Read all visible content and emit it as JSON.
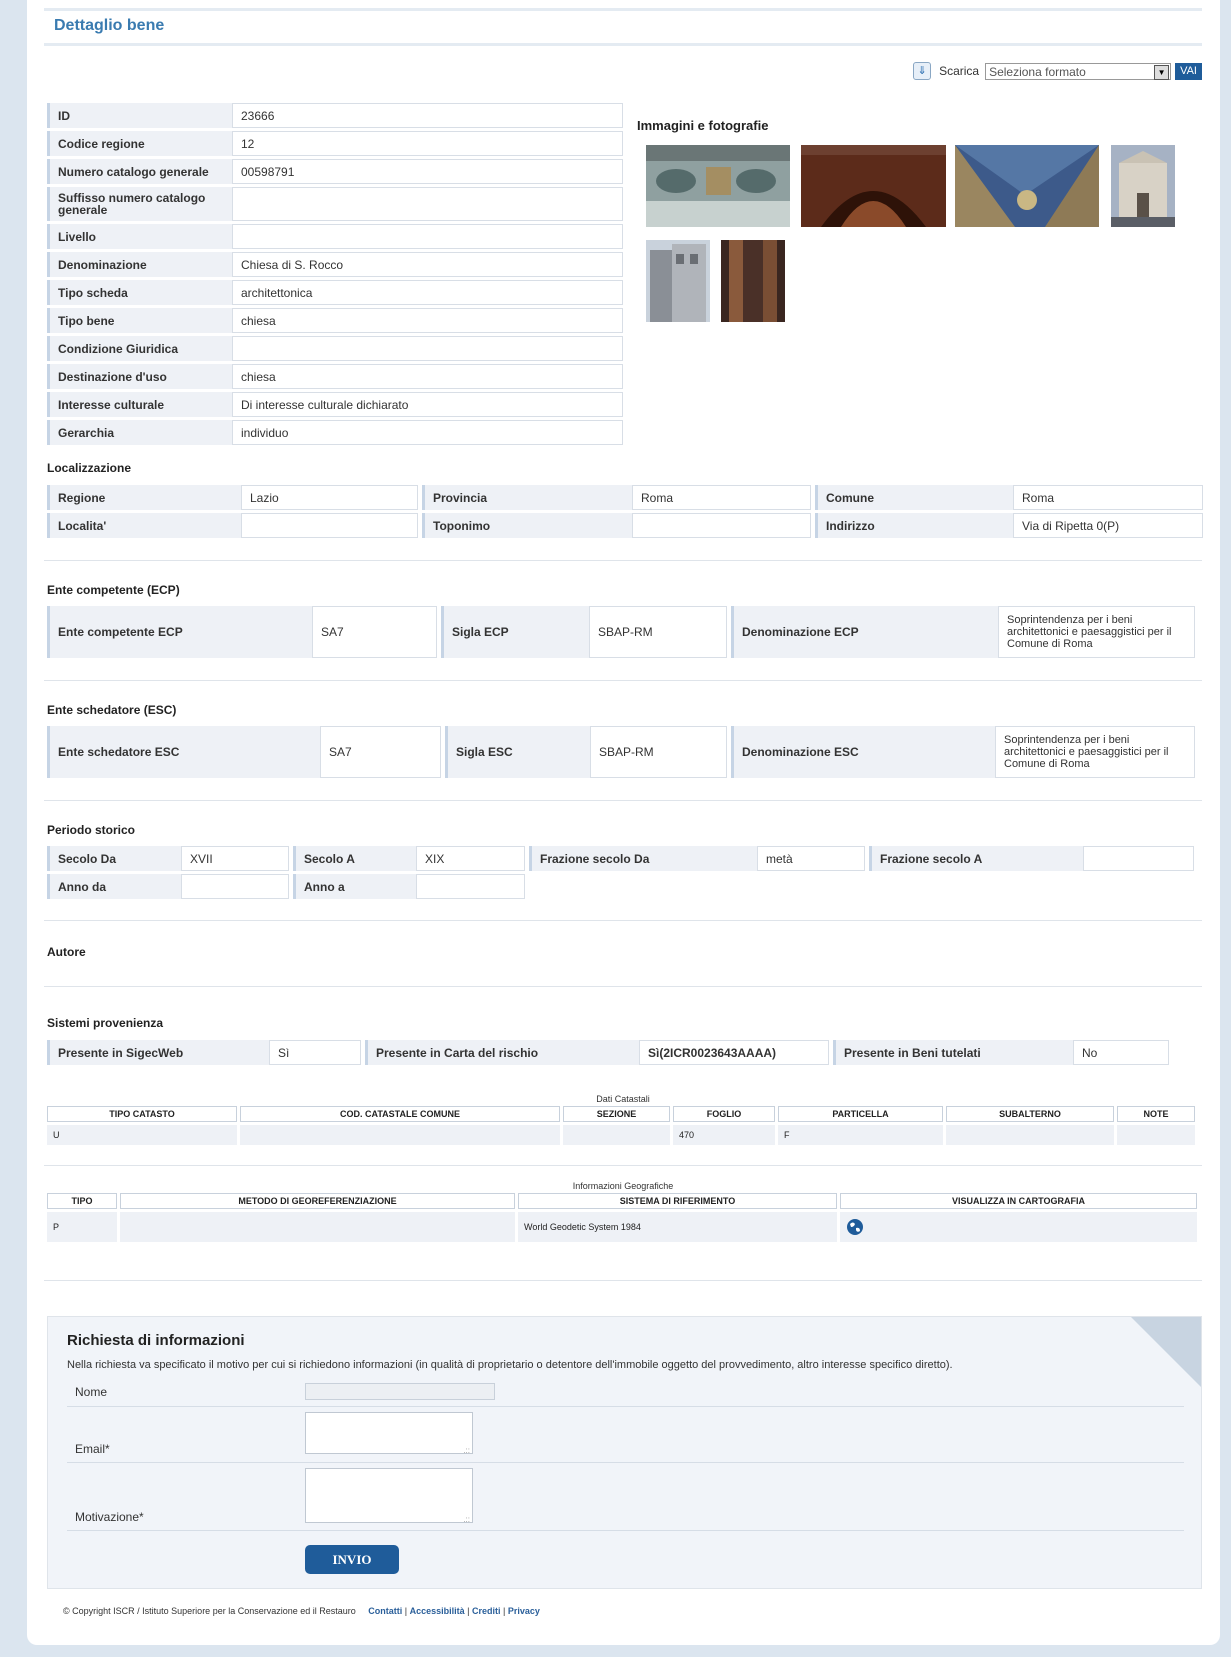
{
  "header": {
    "title": "Dettaglio bene"
  },
  "download": {
    "label": "Scarica",
    "select_value": "Seleziona formato",
    "button": "VAI"
  },
  "details": [
    {
      "label": "ID",
      "value": "23666"
    },
    {
      "label": "Codice regione",
      "value": "12"
    },
    {
      "label": "Numero catalogo generale",
      "value": "00598791"
    },
    {
      "label": "Suffisso numero catalogo generale",
      "value": ""
    },
    {
      "label": "Livello",
      "value": ""
    },
    {
      "label": "Denominazione",
      "value": "Chiesa di S. Rocco"
    },
    {
      "label": "Tipo scheda",
      "value": "architettonica"
    },
    {
      "label": "Tipo bene",
      "value": "chiesa"
    },
    {
      "label": "Condizione Giuridica",
      "value": ""
    },
    {
      "label": "Destinazione d'uso",
      "value": "chiesa"
    },
    {
      "label": "Interesse culturale",
      "value": "Di interesse culturale dichiarato"
    },
    {
      "label": "Gerarchia",
      "value": "individuo"
    }
  ],
  "images": {
    "title": "Immagini e fotografie"
  },
  "localizzazione": {
    "title": "Localizzazione",
    "regione_label": "Regione",
    "regione": "Lazio",
    "provincia_label": "Provincia",
    "provincia": "Roma",
    "comune_label": "Comune",
    "comune": "Roma",
    "localita_label": "Localita'",
    "localita": "",
    "toponimo_label": "Toponimo",
    "toponimo": "",
    "indirizzo_label": "Indirizzo",
    "indirizzo": "Via di Ripetta 0(P)"
  },
  "ecp": {
    "title": "Ente competente (ECP)",
    "ente_label": "Ente competente ECP",
    "ente": "SA7",
    "sigla_label": "Sigla ECP",
    "sigla": "SBAP-RM",
    "den_label": "Denominazione ECP",
    "den": "Soprintendenza per i beni architettonici e paesaggistici per il Comune di Roma"
  },
  "esc": {
    "title": "Ente schedatore (ESC)",
    "ente_label": "Ente schedatore ESC",
    "ente": "SA7",
    "sigla_label": "Sigla ESC",
    "sigla": "SBAP-RM",
    "den_label": "Denominazione ESC",
    "den": "Soprintendenza per i beni architettonici e paesaggistici per il Comune di Roma"
  },
  "periodo": {
    "title": "Periodo storico",
    "secolo_da_label": "Secolo Da",
    "secolo_da": "XVII",
    "secolo_a_label": "Secolo A",
    "secolo_a": "XIX",
    "fraz_da_label": "Frazione secolo Da",
    "fraz_da": "metà",
    "fraz_a_label": "Frazione secolo A",
    "fraz_a": "",
    "anno_da_label": "Anno da",
    "anno_da": "",
    "anno_a_label": "Anno a",
    "anno_a": ""
  },
  "autore": {
    "title": "Autore"
  },
  "sistemi": {
    "title": "Sistemi provenienza",
    "sigec_label": "Presente in SigecWeb",
    "sigec": "Sì",
    "carta_label": "Presente in Carta del rischio",
    "carta": "Sì(2ICR0023643AAAA)",
    "beni_label": "Presente in Beni tutelati",
    "beni": "No"
  },
  "catastali": {
    "caption": "Dati Catastali",
    "headers": [
      "TIPO CATASTO",
      "COD. CATASTALE COMUNE",
      "SEZIONE",
      "FOGLIO",
      "PARTICELLA",
      "SUBALTERNO",
      "NOTE"
    ],
    "row": [
      "U",
      "",
      "",
      "470",
      "F",
      "",
      ""
    ]
  },
  "geo": {
    "caption": "Informazioni Geografiche",
    "headers": [
      "TIPO",
      "METODO DI GEOREFERENZIAZIONE",
      "SISTEMA DI RIFERIMENTO",
      "VISUALIZZA IN CARTOGRAFIA"
    ],
    "row": [
      "P",
      "",
      "World Geodetic System 1984",
      ""
    ]
  },
  "form": {
    "title": "Richiesta di informazioni",
    "desc": "Nella richiesta va specificato il motivo per cui si richiedono informazioni (in qualità di proprietario o detentore dell'immobile oggetto del provvedimento, altro interesse specifico diretto).",
    "nome": "Nome",
    "email": "Email*",
    "motivazione": "Motivazione*",
    "submit": "INVIO"
  },
  "footer": {
    "copyright": "© Copyright ISCR / Istituto Superiore per la Conservazione ed il Restauro",
    "contatti": "Contatti",
    "accessibilita": "Accessibilità",
    "crediti": "Crediti",
    "privacy": "Privacy"
  }
}
